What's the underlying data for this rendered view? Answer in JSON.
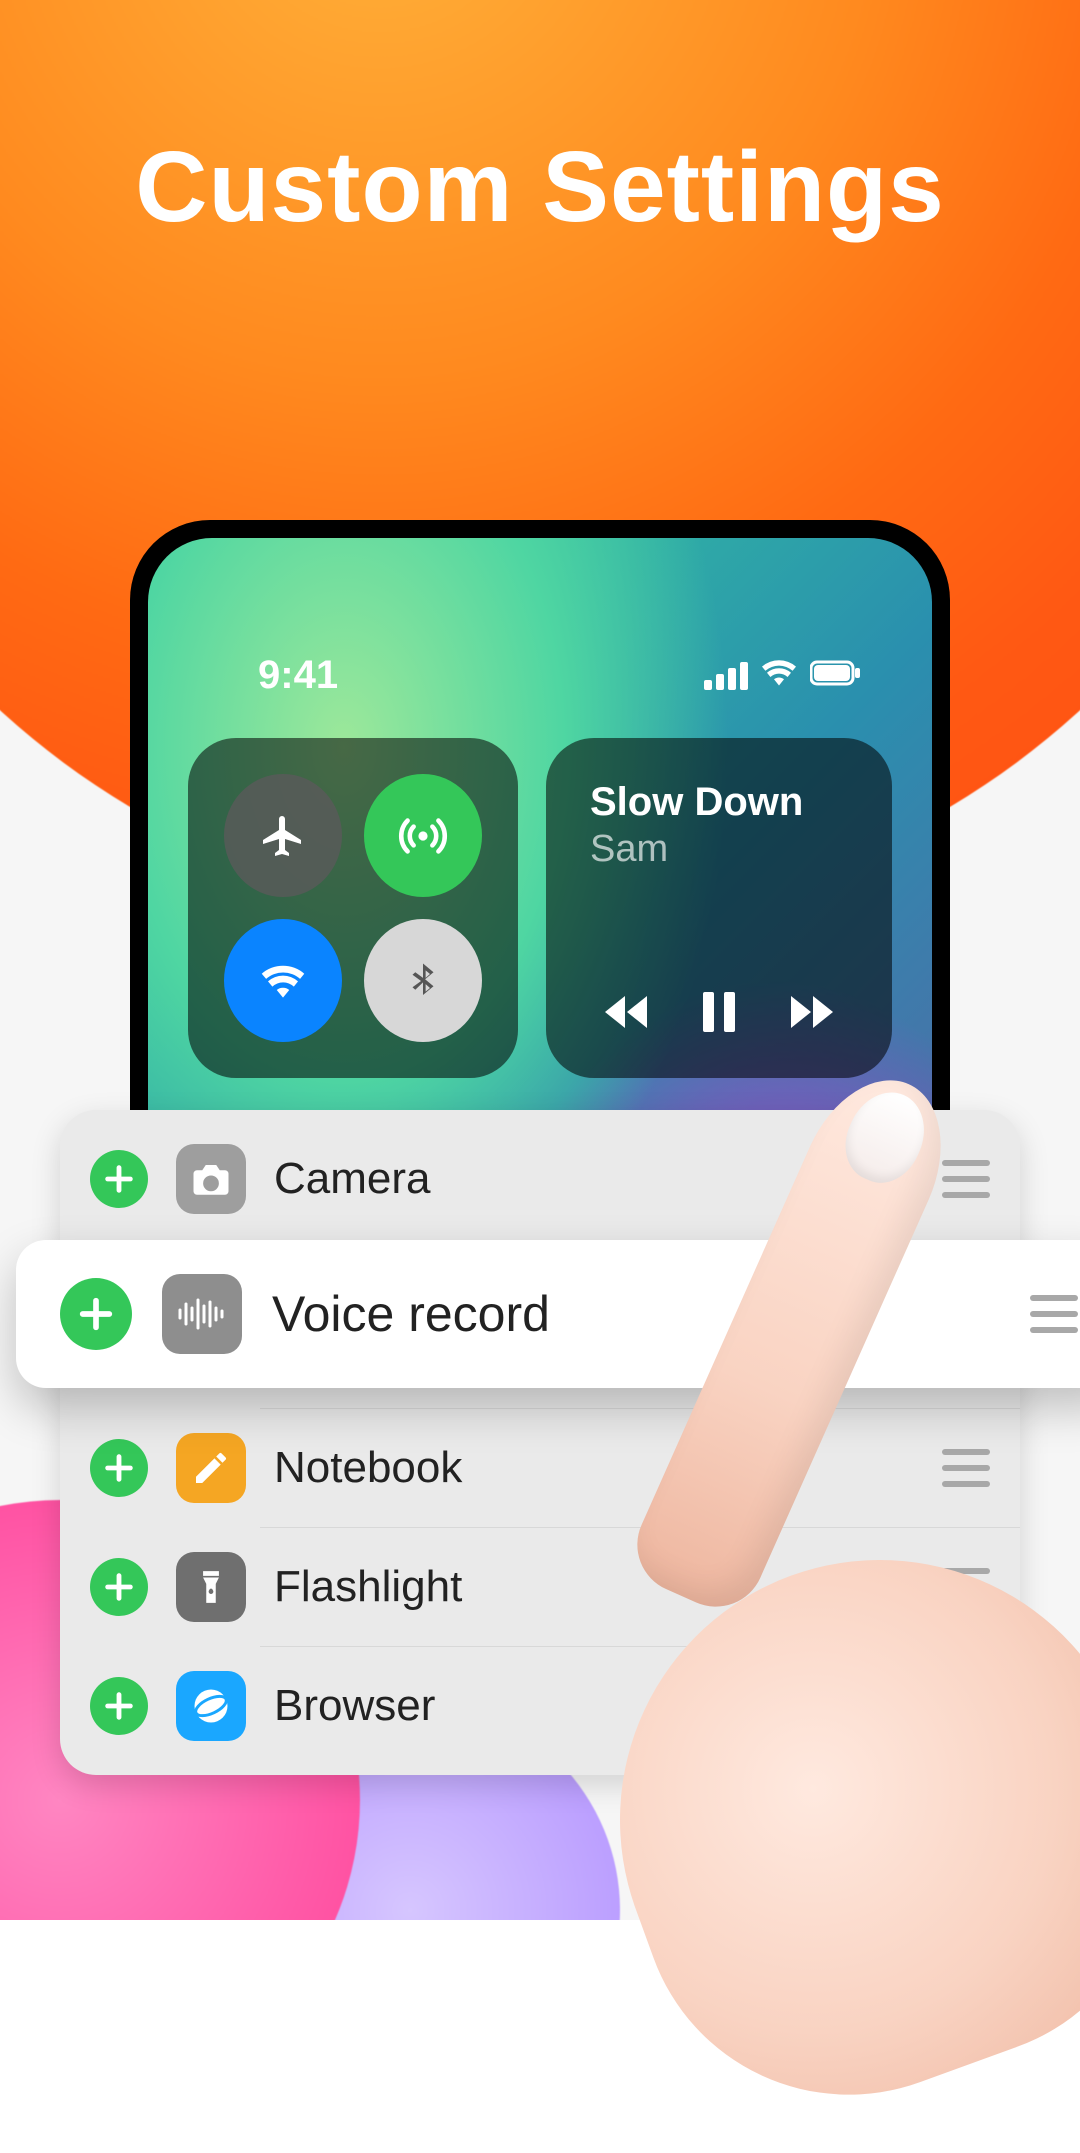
{
  "headline": "Custom Settings",
  "statusbar": {
    "time": "9:41"
  },
  "media": {
    "title": "Slow Down",
    "artist": "Sam"
  },
  "rows": {
    "camera": {
      "label": "Camera"
    },
    "voice": {
      "label": "Voice record"
    },
    "notebook": {
      "label": "Notebook"
    },
    "flashlight": {
      "label": "Flashlight"
    },
    "browser": {
      "label": "Browser"
    }
  }
}
